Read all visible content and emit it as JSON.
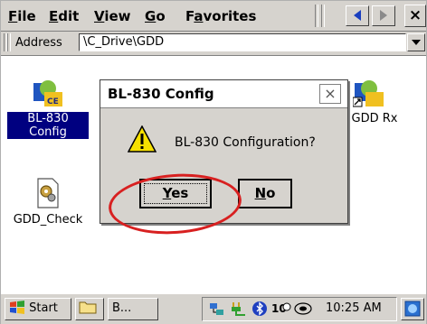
{
  "menubar": {
    "items": [
      {
        "label_pre": "",
        "label_u": "F",
        "label_post": "ile"
      },
      {
        "label_pre": "",
        "label_u": "E",
        "label_post": "dit"
      },
      {
        "label_pre": "",
        "label_u": "V",
        "label_post": "iew"
      },
      {
        "label_pre": "",
        "label_u": "G",
        "label_post": "o"
      },
      {
        "label_pre": "F",
        "label_u": "a",
        "label_post": "vorites"
      }
    ],
    "close_label": "×",
    "back_icon": "back-arrow-icon",
    "forward_icon": "forward-arrow-icon"
  },
  "address": {
    "label": "Address",
    "value": "\\C_Drive\\GDD"
  },
  "desktop": {
    "icons": [
      {
        "label": "BL-830 Config",
        "icon": "app-icon",
        "selected": true
      },
      {
        "label": "GDD Rx",
        "icon": "app-shortcut-icon",
        "selected": false
      },
      {
        "label": "GDD_Check",
        "icon": "gear-document-icon",
        "selected": false
      }
    ]
  },
  "dialog": {
    "title": "BL-830 Config",
    "close_label": "×",
    "message": "BL-830 Configuration?",
    "icon": "warning-icon",
    "yes_u": "Y",
    "yes_rest": "es",
    "no_u": "N",
    "no_rest": "o"
  },
  "annotation": {
    "color": "#d82020"
  },
  "taskbar": {
    "start_label": "Start",
    "task_label": "B...",
    "clock": "10:25 AM"
  },
  "colors": {
    "chrome": "#d6d3ce",
    "selection": "#000080"
  }
}
